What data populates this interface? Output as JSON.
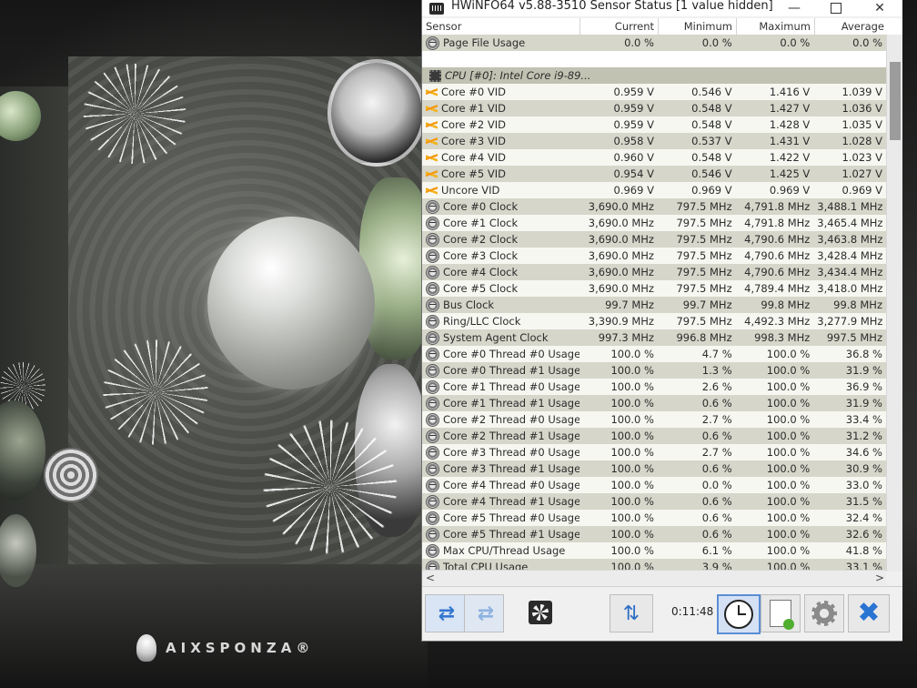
{
  "window": {
    "title": "HWiNFO64 v5.88-3510 Sensor Status [1 value hidden]",
    "minimize_glyph": "—",
    "close_glyph": "✕"
  },
  "columns": {
    "sensor": "Sensor",
    "current": "Current",
    "minimum": "Minimum",
    "maximum": "Maximum",
    "average": "Average"
  },
  "rows": [
    {
      "type": "data",
      "icon": "gauge-icon",
      "name": "Page File Usage",
      "current": "0.0 %",
      "min": "0.0 %",
      "max": "0.0 %",
      "avg": "0.0 %"
    },
    {
      "type": "blank"
    },
    {
      "type": "group",
      "icon": "chip-icon",
      "name": "CPU [#0]: Intel Core i9-89..."
    },
    {
      "type": "data",
      "icon": "voltage-icon",
      "name": "Core #0 VID",
      "current": "0.959 V",
      "min": "0.546 V",
      "max": "1.416 V",
      "avg": "1.039 V"
    },
    {
      "type": "data",
      "icon": "voltage-icon",
      "name": "Core #1 VID",
      "current": "0.959 V",
      "min": "0.548 V",
      "max": "1.427 V",
      "avg": "1.036 V"
    },
    {
      "type": "data",
      "icon": "voltage-icon",
      "name": "Core #2 VID",
      "current": "0.959 V",
      "min": "0.548 V",
      "max": "1.428 V",
      "avg": "1.035 V"
    },
    {
      "type": "data",
      "icon": "voltage-icon",
      "name": "Core #3 VID",
      "current": "0.958 V",
      "min": "0.537 V",
      "max": "1.431 V",
      "avg": "1.028 V"
    },
    {
      "type": "data",
      "icon": "voltage-icon",
      "name": "Core #4 VID",
      "current": "0.960 V",
      "min": "0.548 V",
      "max": "1.422 V",
      "avg": "1.023 V"
    },
    {
      "type": "data",
      "icon": "voltage-icon",
      "name": "Core #5 VID",
      "current": "0.954 V",
      "min": "0.546 V",
      "max": "1.425 V",
      "avg": "1.027 V"
    },
    {
      "type": "data",
      "icon": "voltage-icon",
      "name": "Uncore VID",
      "current": "0.969 V",
      "min": "0.969 V",
      "max": "0.969 V",
      "avg": "0.969 V"
    },
    {
      "type": "data",
      "icon": "gauge-icon",
      "name": "Core #0 Clock",
      "current": "3,690.0 MHz",
      "min": "797.5 MHz",
      "max": "4,791.8 MHz",
      "avg": "3,488.1 MHz"
    },
    {
      "type": "data",
      "icon": "gauge-icon",
      "name": "Core #1 Clock",
      "current": "3,690.0 MHz",
      "min": "797.5 MHz",
      "max": "4,791.8 MHz",
      "avg": "3,465.4 MHz"
    },
    {
      "type": "data",
      "icon": "gauge-icon",
      "name": "Core #2 Clock",
      "current": "3,690.0 MHz",
      "min": "797.5 MHz",
      "max": "4,790.6 MHz",
      "avg": "3,463.8 MHz"
    },
    {
      "type": "data",
      "icon": "gauge-icon",
      "name": "Core #3 Clock",
      "current": "3,690.0 MHz",
      "min": "797.5 MHz",
      "max": "4,790.6 MHz",
      "avg": "3,428.4 MHz"
    },
    {
      "type": "data",
      "icon": "gauge-icon",
      "name": "Core #4 Clock",
      "current": "3,690.0 MHz",
      "min": "797.5 MHz",
      "max": "4,790.6 MHz",
      "avg": "3,434.4 MHz"
    },
    {
      "type": "data",
      "icon": "gauge-icon",
      "name": "Core #5 Clock",
      "current": "3,690.0 MHz",
      "min": "797.5 MHz",
      "max": "4,789.4 MHz",
      "avg": "3,418.0 MHz"
    },
    {
      "type": "data",
      "icon": "gauge-icon",
      "name": "Bus Clock",
      "current": "99.7 MHz",
      "min": "99.7 MHz",
      "max": "99.8 MHz",
      "avg": "99.8 MHz"
    },
    {
      "type": "data",
      "icon": "gauge-icon",
      "name": "Ring/LLC Clock",
      "current": "3,390.9 MHz",
      "min": "797.5 MHz",
      "max": "4,492.3 MHz",
      "avg": "3,277.9 MHz"
    },
    {
      "type": "data",
      "icon": "gauge-icon",
      "name": "System Agent Clock",
      "current": "997.3 MHz",
      "min": "996.8 MHz",
      "max": "998.3 MHz",
      "avg": "997.5 MHz"
    },
    {
      "type": "data",
      "icon": "gauge-icon",
      "name": "Core #0 Thread #0 Usage",
      "current": "100.0 %",
      "min": "4.7 %",
      "max": "100.0 %",
      "avg": "36.8 %"
    },
    {
      "type": "data",
      "icon": "gauge-icon",
      "name": "Core #0 Thread #1 Usage",
      "current": "100.0 %",
      "min": "1.3 %",
      "max": "100.0 %",
      "avg": "31.9 %"
    },
    {
      "type": "data",
      "icon": "gauge-icon",
      "name": "Core #1 Thread #0 Usage",
      "current": "100.0 %",
      "min": "2.6 %",
      "max": "100.0 %",
      "avg": "36.9 %"
    },
    {
      "type": "data",
      "icon": "gauge-icon",
      "name": "Core #1 Thread #1 Usage",
      "current": "100.0 %",
      "min": "0.6 %",
      "max": "100.0 %",
      "avg": "31.9 %"
    },
    {
      "type": "data",
      "icon": "gauge-icon",
      "name": "Core #2 Thread #0 Usage",
      "current": "100.0 %",
      "min": "2.7 %",
      "max": "100.0 %",
      "avg": "33.4 %"
    },
    {
      "type": "data",
      "icon": "gauge-icon",
      "name": "Core #2 Thread #1 Usage",
      "current": "100.0 %",
      "min": "0.6 %",
      "max": "100.0 %",
      "avg": "31.2 %"
    },
    {
      "type": "data",
      "icon": "gauge-icon",
      "name": "Core #3 Thread #0 Usage",
      "current": "100.0 %",
      "min": "2.7 %",
      "max": "100.0 %",
      "avg": "34.6 %"
    },
    {
      "type": "data",
      "icon": "gauge-icon",
      "name": "Core #3 Thread #1 Usage",
      "current": "100.0 %",
      "min": "0.6 %",
      "max": "100.0 %",
      "avg": "30.9 %"
    },
    {
      "type": "data",
      "icon": "gauge-icon",
      "name": "Core #4 Thread #0 Usage",
      "current": "100.0 %",
      "min": "0.0 %",
      "max": "100.0 %",
      "avg": "33.0 %"
    },
    {
      "type": "data",
      "icon": "gauge-icon",
      "name": "Core #4 Thread #1 Usage",
      "current": "100.0 %",
      "min": "0.6 %",
      "max": "100.0 %",
      "avg": "31.5 %"
    },
    {
      "type": "data",
      "icon": "gauge-icon",
      "name": "Core #5 Thread #0 Usage",
      "current": "100.0 %",
      "min": "0.6 %",
      "max": "100.0 %",
      "avg": "32.4 %"
    },
    {
      "type": "data",
      "icon": "gauge-icon",
      "name": "Core #5 Thread #1 Usage",
      "current": "100.0 %",
      "min": "0.6 %",
      "max": "100.0 %",
      "avg": "32.6 %"
    },
    {
      "type": "data",
      "icon": "gauge-icon",
      "name": "Max CPU/Thread Usage",
      "current": "100.0 %",
      "min": "6.1 %",
      "max": "100.0 %",
      "avg": "41.8 %"
    },
    {
      "type": "data",
      "icon": "gauge-icon",
      "name": "Total CPU Usage",
      "current": "100.0 %",
      "min": "3.9 %",
      "max": "100.0 %",
      "avg": "33.1 %"
    }
  ],
  "scroll": {
    "left_glyph": "<",
    "right_glyph": ">"
  },
  "toolbar": {
    "nav_prev_glyph": "⇄",
    "nav_next_glyph": "⇄",
    "timer": "0:11:48",
    "exit_glyph": "✖"
  },
  "desktop": {
    "brand": "AIXSPONZA®"
  },
  "colors": {
    "row_alt": "#d6d6ca",
    "row_group": "#c2c2b2",
    "accent_blue": "#2a74d2"
  }
}
